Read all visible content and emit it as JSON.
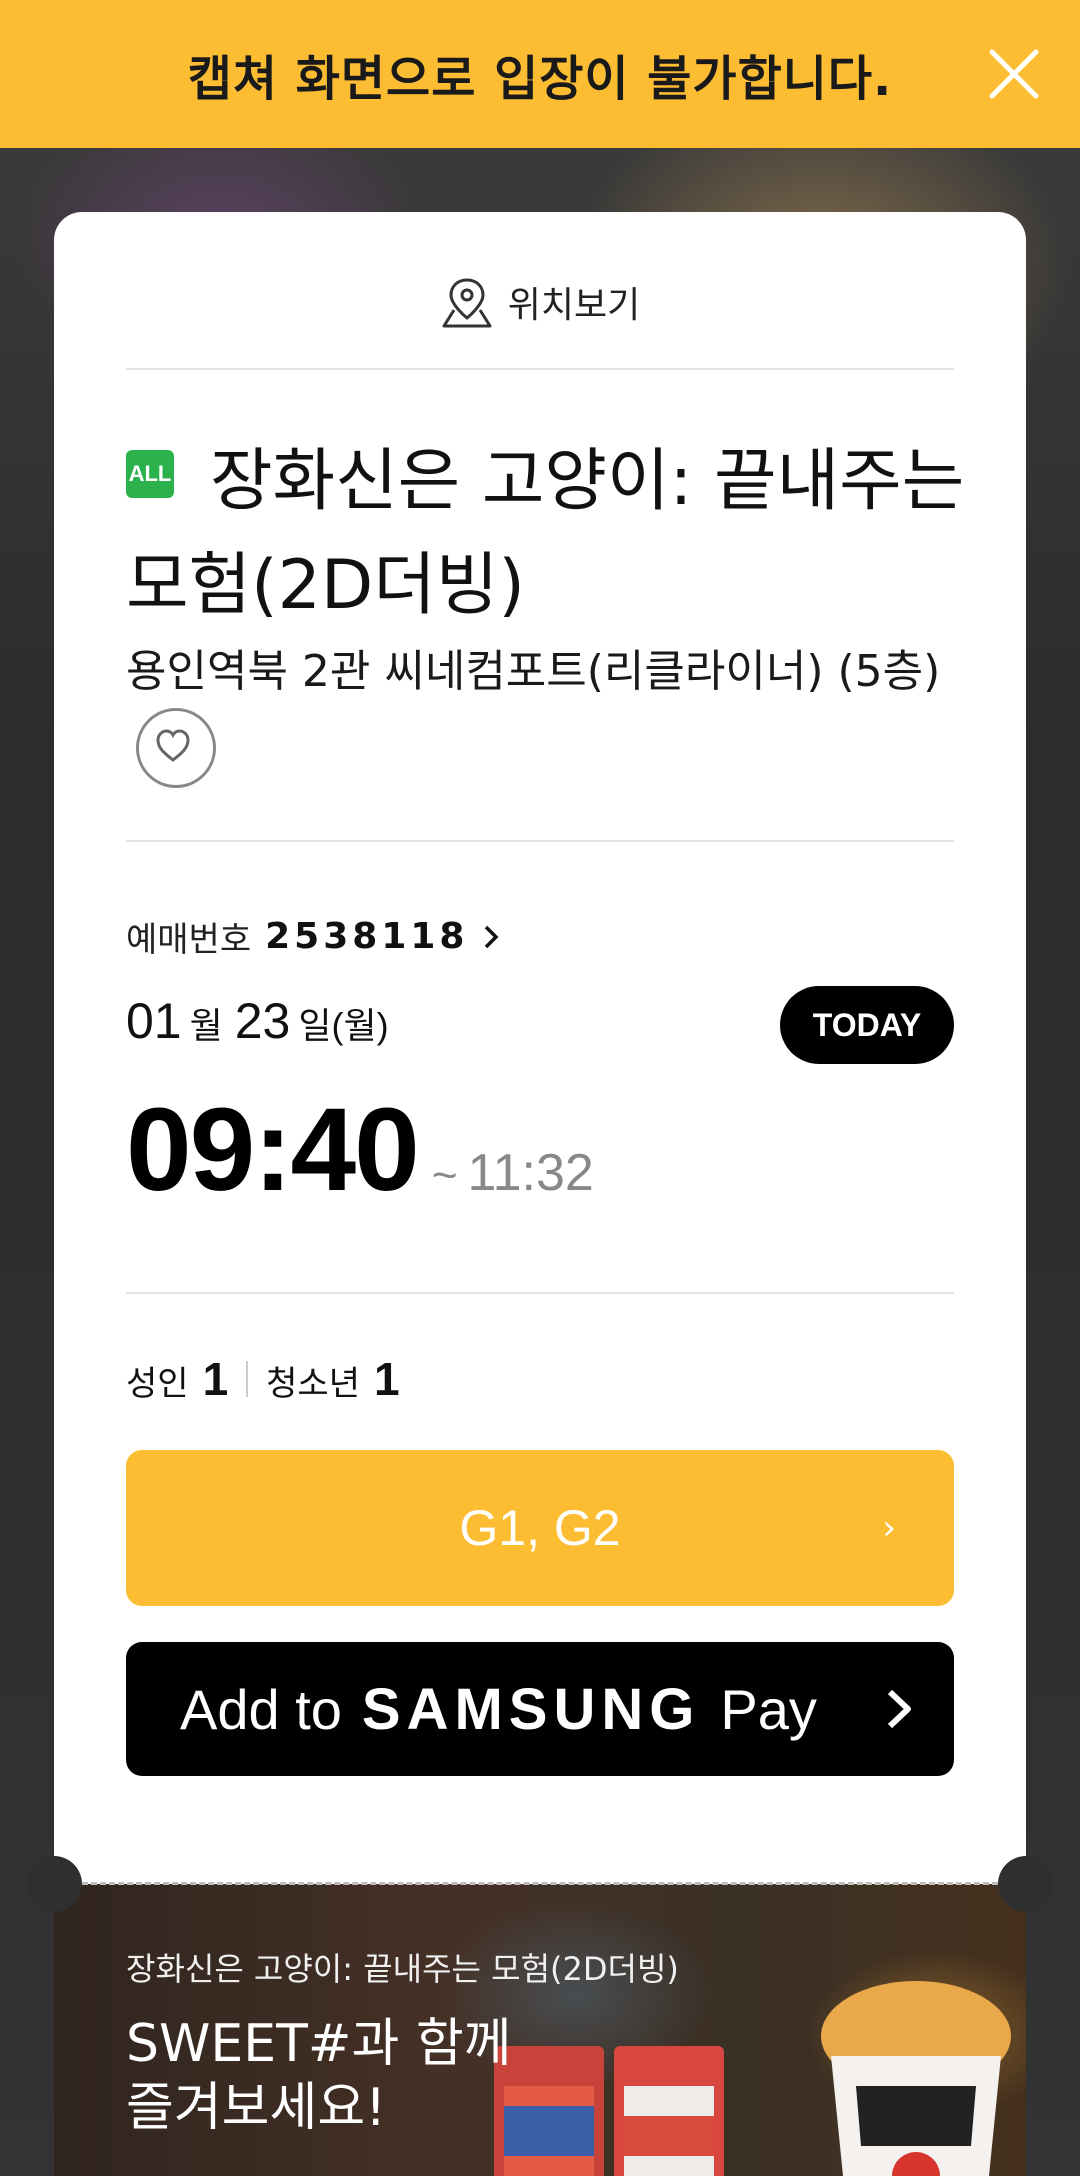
{
  "banner": {
    "text": "캡쳐 화면으로 입장이 불가합니다."
  },
  "ticket": {
    "location_label": "위치보기",
    "rating_badge": "ALL",
    "movie_title": "장화신은 고양이: 끝내주는 모험(2D더빙)",
    "venue": "용인역북 2관 씨네컴포트(리클라이너) (5층)",
    "reservation": {
      "label": "예매번호",
      "number": "2538118"
    },
    "date": {
      "month": "01",
      "month_unit": "월",
      "day": "23",
      "day_unit": "일(월)"
    },
    "today_badge": "TODAY",
    "time": {
      "start": "09:40",
      "separator": "~",
      "end": "11:32"
    },
    "people": [
      {
        "label": "성인",
        "count": "1"
      },
      {
        "label": "청소년",
        "count": "1"
      }
    ],
    "seats": "G1, G2",
    "samsung_pay": {
      "prefix": "Add to",
      "brand": "SAMSUNG",
      "suffix": "Pay"
    }
  },
  "promo": {
    "subtitle": "장화신은 고양이: 끝내주는 모험(2D더빙)",
    "headline_line1": "SWEET#과 함께",
    "headline_line2": "즐겨보세요!"
  },
  "colors": {
    "accent": "#fdbd33",
    "rating_green": "#2bb24c",
    "black": "#000000"
  }
}
